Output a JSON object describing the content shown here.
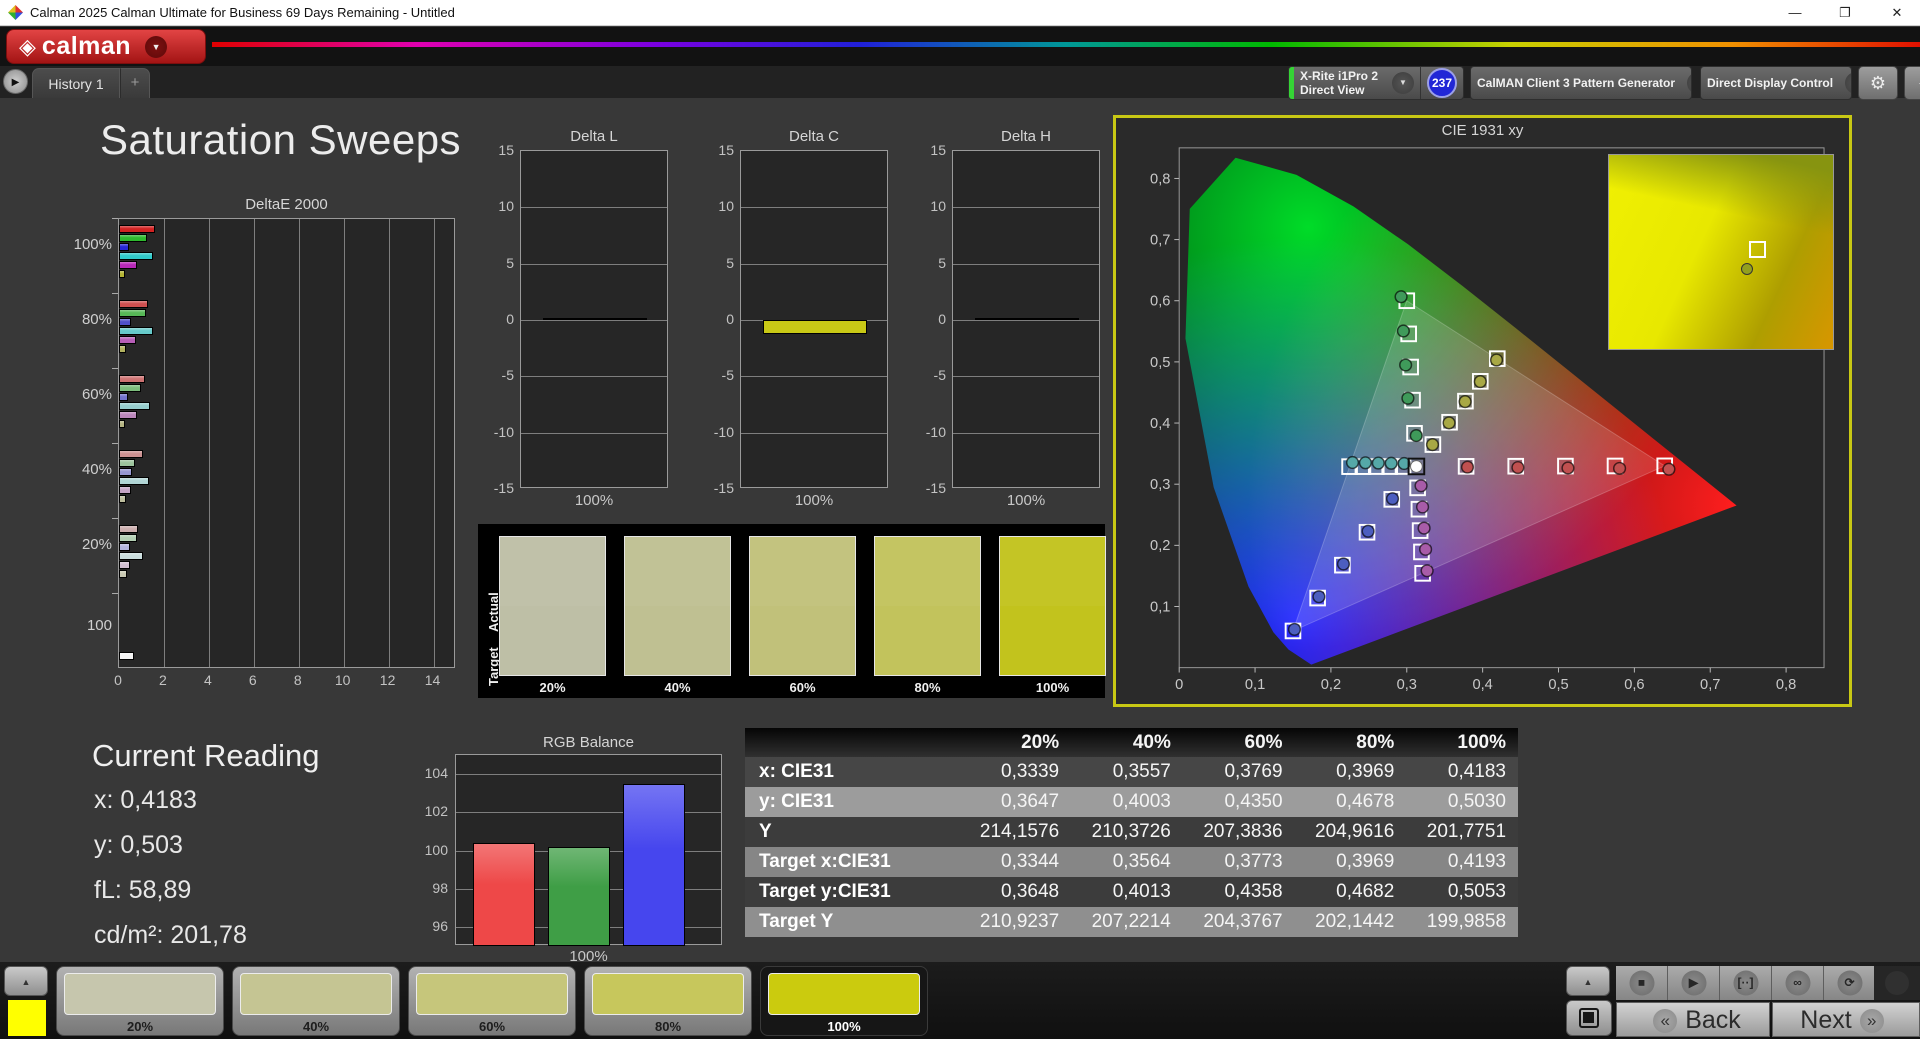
{
  "window": {
    "title": "Calman 2025 Calman Ultimate for Business 69 Days Remaining  - Untitled",
    "minimize_glyph": "—",
    "restore_glyph": "❐",
    "close_glyph": "✕"
  },
  "brand": {
    "logo_glyph": "◈",
    "logo_text": "calman",
    "dropdown_glyph": "▼"
  },
  "tabs": {
    "run_glyph": "▶",
    "history_label": "History 1",
    "add_label": "+"
  },
  "meters": [
    {
      "line1": "X-Rite i1Pro 2",
      "line2": "Direct View",
      "stripe": "#35d435",
      "badge": "237"
    },
    {
      "line1": "CalMAN Client 3 Pattern Generator",
      "line2": "",
      "stripe": "#35d435"
    },
    {
      "line1": "Direct Display Control",
      "line2": "",
      "stripe": "#e0e000"
    }
  ],
  "topbar": {
    "settings_glyph": "⚙",
    "collapse_glyph": "◀"
  },
  "page": {
    "title": "Saturation Sweeps"
  },
  "current_reading": {
    "title": "Current Reading",
    "x": "x: 0,4183",
    "y": "y: 0,503",
    "fl": "fL: 58,89",
    "cdm2": "cd/m²: 201,78"
  },
  "swatch_panel": {
    "row_labels": [
      "Actual",
      "Target"
    ],
    "swatches": [
      {
        "label": "20%",
        "color": "#bebfa6"
      },
      {
        "label": "40%",
        "color": "#bfc092"
      },
      {
        "label": "60%",
        "color": "#c1c17a"
      },
      {
        "label": "80%",
        "color": "#c2c35c"
      },
      {
        "label": "100%",
        "color": "#c2c31d"
      }
    ]
  },
  "bottom": {
    "sidecar": {
      "up_glyph": "▲",
      "swatch_color": "#ffff00"
    },
    "patterns": [
      {
        "label": "20%",
        "color": "#c6c6ad",
        "selected": false
      },
      {
        "label": "40%",
        "color": "#c5c593",
        "selected": false
      },
      {
        "label": "60%",
        "color": "#c6c67b",
        "selected": false
      },
      {
        "label": "80%",
        "color": "#c7c75c",
        "selected": false
      },
      {
        "label": "100%",
        "color": "#cbcb0e",
        "selected": true
      }
    ],
    "window_control": {
      "up_glyph": "▲"
    },
    "transport": [
      {
        "name": "stop",
        "glyph": "■"
      },
      {
        "name": "play",
        "glyph": "▶"
      },
      {
        "name": "measure",
        "glyph": "[··]"
      },
      {
        "name": "continuous",
        "glyph": "∞"
      },
      {
        "name": "refresh",
        "glyph": "⟳"
      }
    ],
    "nav": {
      "back_glyph": "«",
      "back": "Back",
      "next": "Next",
      "next_glyph": "»"
    }
  },
  "chart_data": [
    {
      "type": "bar",
      "orientation": "horizontal",
      "title": "DeltaE 2000",
      "xlim": [
        0,
        15
      ],
      "xticks": [
        0,
        2,
        4,
        6,
        8,
        10,
        12,
        14
      ],
      "groups": [
        {
          "label": "100%",
          "values": [
            1.6,
            1.25,
            0.45,
            1.5,
            0.8,
            0.25
          ],
          "colors": [
            "#d22222",
            "#2eb82e",
            "#2626d6",
            "#30caca",
            "#b828b8",
            "#b4b434"
          ]
        },
        {
          "label": "80%",
          "values": [
            1.3,
            1.2,
            0.55,
            1.5,
            0.75,
            0.3
          ],
          "colors": [
            "#cf4f4f",
            "#57b857",
            "#5050c9",
            "#66caca",
            "#b75eb7",
            "#b2b260"
          ]
        },
        {
          "label": "60%",
          "values": [
            1.15,
            1.0,
            0.4,
            1.4,
            0.8,
            0.25
          ],
          "colors": [
            "#cd7272",
            "#7cbc7c",
            "#7272cc",
            "#95cdcd",
            "#bb86bb",
            "#b4b482"
          ]
        },
        {
          "label": "40%",
          "values": [
            1.05,
            0.7,
            0.6,
            1.35,
            0.55,
            0.3
          ],
          "colors": [
            "#cc9191",
            "#9dc49d",
            "#9797d2",
            "#b1d5d5",
            "#c5a4c5",
            "#bdbd9d"
          ]
        },
        {
          "label": "20%",
          "values": [
            0.85,
            0.8,
            0.5,
            1.05,
            0.5,
            0.35
          ],
          "colors": [
            "#ccaeae",
            "#b3ceb3",
            "#b3b3dd",
            "#c9dddd",
            "#d0bdd0",
            "#c7c7b1"
          ]
        },
        {
          "label": "100",
          "values": [
            0.65
          ],
          "colors": [
            "#f2f2f2"
          ]
        }
      ]
    },
    {
      "type": "bar",
      "title": "Delta L",
      "ylim": [
        -15,
        15
      ],
      "yticks": [
        15,
        10,
        5,
        0,
        -5,
        -10,
        -15
      ],
      "xlabel": "100%",
      "value": 0.18,
      "color": "#b9b95c"
    },
    {
      "type": "bar",
      "title": "Delta C",
      "ylim": [
        -15,
        15
      ],
      "yticks": [
        15,
        10,
        5,
        0,
        -5,
        -10,
        -15
      ],
      "xlabel": "100%",
      "value": -1.2,
      "color": "#c9c916"
    },
    {
      "type": "bar",
      "title": "Delta H",
      "ylim": [
        -15,
        15
      ],
      "yticks": [
        15,
        10,
        5,
        0,
        -5,
        -10,
        -15
      ],
      "xlabel": "100%",
      "value": 0.05,
      "color": "#1e1e1e"
    },
    {
      "type": "scatter",
      "title": "CIE 1931 xy",
      "xlim": [
        0,
        0.85
      ],
      "ylim": [
        0,
        0.85
      ],
      "tick_labels": [
        "0",
        "0,1",
        "0,2",
        "0,3",
        "0,4",
        "0,5",
        "0,6",
        "0,7",
        "0,8"
      ],
      "white_point": {
        "x": 0.3127,
        "y": 0.329
      },
      "gamut_triangle": {
        "red": [
          0.64,
          0.33
        ],
        "green": [
          0.3,
          0.6
        ],
        "blue": [
          0.15,
          0.06
        ]
      },
      "sweeps": [
        {
          "name": "red",
          "color": "#c05050",
          "targets": [
            [
              0.3782,
              0.3292
            ],
            [
              0.4436,
              0.3294
            ],
            [
              0.5091,
              0.3296
            ],
            [
              0.5745,
              0.3298
            ],
            [
              0.64,
              0.33
            ]
          ],
          "actuals": [
            [
              0.38,
              0.328
            ],
            [
              0.4465,
              0.3272
            ],
            [
              0.5125,
              0.3265
            ],
            [
              0.5805,
              0.3258
            ],
            [
              0.6455,
              0.3245
            ]
          ]
        },
        {
          "name": "green",
          "color": "#3f9a5a",
          "targets": [
            [
              0.3102,
              0.3832
            ],
            [
              0.3076,
              0.4374
            ],
            [
              0.3051,
              0.4916
            ],
            [
              0.3025,
              0.5458
            ],
            [
              0.3,
              0.6
            ]
          ],
          "actuals": [
            [
              0.3125,
              0.3795
            ],
            [
              0.3015,
              0.4405
            ],
            [
              0.2985,
              0.495
            ],
            [
              0.2955,
              0.5505
            ],
            [
              0.2925,
              0.6065
            ]
          ]
        },
        {
          "name": "blue",
          "color": "#4c5ec0",
          "targets": [
            [
              0.2802,
              0.2752
            ],
            [
              0.2476,
              0.2214
            ],
            [
              0.2151,
              0.1676
            ],
            [
              0.1825,
              0.1138
            ],
            [
              0.15,
              0.06
            ]
          ],
          "actuals": [
            [
              0.2812,
              0.2762
            ],
            [
              0.249,
              0.223
            ],
            [
              0.2165,
              0.1695
            ],
            [
              0.1842,
              0.116
            ],
            [
              0.152,
              0.0625
            ]
          ]
        },
        {
          "name": "cyan",
          "color": "#55a8a8",
          "targets": [
            [
              0.2951,
              0.3289
            ],
            [
              0.2775,
              0.3288
            ],
            [
              0.2598,
              0.3288
            ],
            [
              0.2422,
              0.3287
            ],
            [
              0.2246,
              0.3287
            ]
          ],
          "actuals": [
            [
              0.2965,
              0.3338
            ],
            [
              0.2795,
              0.3342
            ],
            [
              0.2625,
              0.3346
            ],
            [
              0.2455,
              0.335
            ],
            [
              0.2285,
              0.3355
            ]
          ]
        },
        {
          "name": "magenta",
          "color": "#a85ca8",
          "targets": [
            [
              0.3143,
              0.294
            ],
            [
              0.316,
              0.2591
            ],
            [
              0.3176,
              0.2241
            ],
            [
              0.3193,
              0.1892
            ],
            [
              0.3209,
              0.1542
            ]
          ],
          "actuals": [
            [
              0.3188,
              0.2975
            ],
            [
              0.3208,
              0.2628
            ],
            [
              0.3228,
              0.2282
            ],
            [
              0.3248,
              0.1935
            ],
            [
              0.3268,
              0.1585
            ]
          ]
        },
        {
          "name": "yellow",
          "color": "#a8a845",
          "targets": [
            [
              0.3344,
              0.3648
            ],
            [
              0.3564,
              0.4013
            ],
            [
              0.3773,
              0.4358
            ],
            [
              0.3969,
              0.4682
            ],
            [
              0.4193,
              0.5053
            ]
          ],
          "actuals": [
            [
              0.3339,
              0.3647
            ],
            [
              0.3557,
              0.4003
            ],
            [
              0.3769,
              0.435
            ],
            [
              0.3969,
              0.4678
            ],
            [
              0.4183,
              0.503
            ]
          ]
        }
      ],
      "inset": {
        "square": [
          0.62,
          0.44
        ],
        "circle": [
          0.585,
          0.55
        ]
      }
    },
    {
      "type": "bar",
      "title": "RGB Balance",
      "categories": [
        "Red",
        "Green",
        "Blue"
      ],
      "values": [
        100.4,
        100.2,
        103.5
      ],
      "colors": [
        "#ee4848",
        "#3f9e46",
        "#4646ee"
      ],
      "ylim": [
        95,
        105
      ],
      "yticks": [
        104,
        102,
        100,
        98,
        96
      ],
      "xlabel": "100%"
    },
    {
      "type": "table",
      "columns": [
        "",
        "20%",
        "40%",
        "60%",
        "80%",
        "100%"
      ],
      "rows": [
        {
          "label": "x: CIE31",
          "values": [
            "0,3339",
            "0,3557",
            "0,3769",
            "0,3969",
            "0,4183"
          ],
          "bg": "#464646"
        },
        {
          "label": "y: CIE31",
          "values": [
            "0,3647",
            "0,4003",
            "0,4350",
            "0,4678",
            "0,5030"
          ],
          "bg": "#9c9c9c"
        },
        {
          "label": "Y",
          "values": [
            "214,1576",
            "210,3726",
            "207,3836",
            "204,9616",
            "201,7751"
          ],
          "bg": "#3c3c3c"
        },
        {
          "label": "Target x:CIE31",
          "values": [
            "0,3344",
            "0,3564",
            "0,3773",
            "0,3969",
            "0,4193"
          ],
          "bg": "#868686"
        },
        {
          "label": "Target y:CIE31",
          "values": [
            "0,3648",
            "0,4013",
            "0,4358",
            "0,4682",
            "0,5053"
          ],
          "bg": "#3c3c3c"
        },
        {
          "label": "Target Y",
          "values": [
            "210,9237",
            "207,2214",
            "204,3767",
            "202,1442",
            "199,9858"
          ],
          "bg": "#8f8f8f"
        }
      ]
    }
  ]
}
